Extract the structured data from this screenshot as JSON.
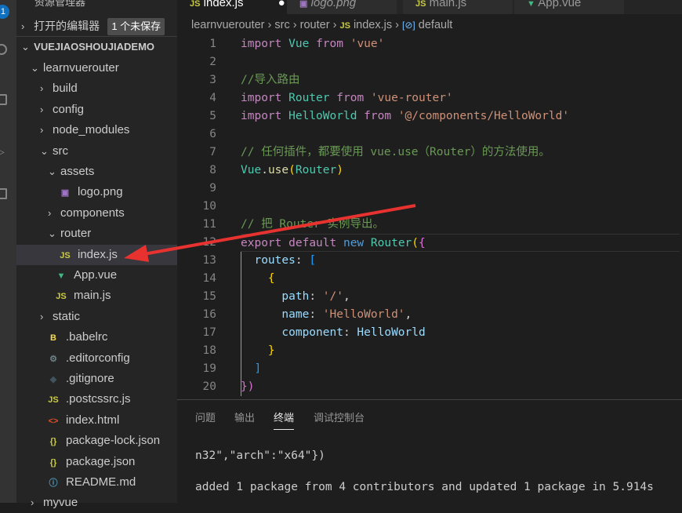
{
  "activity": {
    "badge": "1"
  },
  "sidebar": {
    "title": "资源管理器",
    "more": "···",
    "open_editors": "打开的编辑器",
    "unsaved": "1 个未保存",
    "project": "VUEJIAOSHOUJIADEMO",
    "items": [
      {
        "label": "learnvuerouter",
        "type": "folder-open",
        "indent": 0
      },
      {
        "label": "build",
        "type": "folder",
        "indent": 1
      },
      {
        "label": "config",
        "type": "folder",
        "indent": 1
      },
      {
        "label": "node_modules",
        "type": "folder",
        "indent": 1
      },
      {
        "label": "src",
        "type": "folder-open",
        "indent": 1
      },
      {
        "label": "assets",
        "type": "folder-open",
        "indent": 2
      },
      {
        "label": "logo.png",
        "type": "image",
        "indent": 3
      },
      {
        "label": "components",
        "type": "folder",
        "indent": 2
      },
      {
        "label": "router",
        "type": "folder-open",
        "indent": 2
      },
      {
        "label": "index.js",
        "type": "js",
        "indent": 3,
        "selected": true
      },
      {
        "label": "App.vue",
        "type": "vue",
        "indent": 2
      },
      {
        "label": "main.js",
        "type": "js",
        "indent": 2
      },
      {
        "label": "static",
        "type": "folder",
        "indent": 1
      },
      {
        "label": ".babelrc",
        "type": "babel",
        "indent": 1
      },
      {
        "label": ".editorconfig",
        "type": "gear",
        "indent": 1
      },
      {
        "label": ".gitignore",
        "type": "git",
        "indent": 1
      },
      {
        "label": ".postcssrc.js",
        "type": "js",
        "indent": 1
      },
      {
        "label": "index.html",
        "type": "html",
        "indent": 1
      },
      {
        "label": "package-lock.json",
        "type": "json",
        "indent": 1
      },
      {
        "label": "package.json",
        "type": "json",
        "indent": 1
      },
      {
        "label": "README.md",
        "type": "info",
        "indent": 1
      },
      {
        "label": "myvue",
        "type": "folder",
        "indent": 0
      }
    ]
  },
  "tabs": [
    {
      "label": "index.js",
      "icon": "JS",
      "active": true,
      "dirty": "●"
    },
    {
      "label": "logo.png",
      "icon": "▣"
    },
    {
      "label": "main.js",
      "icon": "JS"
    },
    {
      "label": "App.vue",
      "icon": "▼"
    }
  ],
  "breadcrumb": {
    "parts": [
      "learnvuerouter",
      "src",
      "router",
      "index.js",
      "default"
    ],
    "js": "JS",
    "symbol": "[⊘]"
  },
  "code": [
    [
      [
        "import",
        "kw"
      ],
      [
        " ",
        "pl"
      ],
      [
        "Vue",
        "cls"
      ],
      [
        " ",
        "pl"
      ],
      [
        "from",
        "kw"
      ],
      [
        " ",
        "pl"
      ],
      [
        "'vue'",
        "str"
      ]
    ],
    [],
    [
      [
        "//导入路由",
        "cm"
      ]
    ],
    [
      [
        "import",
        "kw"
      ],
      [
        " ",
        "pl"
      ],
      [
        "Router",
        "cls"
      ],
      [
        " ",
        "pl"
      ],
      [
        "from",
        "kw"
      ],
      [
        " ",
        "pl"
      ],
      [
        "'vue-router'",
        "str"
      ]
    ],
    [
      [
        "import",
        "kw"
      ],
      [
        " ",
        "pl"
      ],
      [
        "HelloWorld",
        "cls"
      ],
      [
        " ",
        "pl"
      ],
      [
        "from",
        "kw"
      ],
      [
        " ",
        "pl"
      ],
      [
        "'@/components/HelloWorld'",
        "str"
      ]
    ],
    [],
    [
      [
        "// 任何插件，都要使用 vue.use（Router）的方法使用。",
        "cm"
      ]
    ],
    [
      [
        "Vue",
        "cls"
      ],
      [
        ".",
        "pl"
      ],
      [
        "use",
        "fn"
      ],
      [
        "(",
        "br1"
      ],
      [
        "Router",
        "cls"
      ],
      [
        ")",
        "br1"
      ]
    ],
    [],
    [],
    [
      [
        "// 把 Router 实例导出。",
        "cm"
      ]
    ],
    [
      [
        "export",
        "kw"
      ],
      [
        " ",
        "pl"
      ],
      [
        "default",
        "kw"
      ],
      [
        " ",
        "pl"
      ],
      [
        "new",
        "blue"
      ],
      [
        " ",
        "pl"
      ],
      [
        "Router",
        "cls"
      ],
      [
        "(",
        "br1"
      ],
      [
        "{",
        "br2"
      ]
    ],
    [
      [
        "  routes",
        "var"
      ],
      [
        ": ",
        "pl"
      ],
      [
        "[",
        "br3"
      ]
    ],
    [
      [
        "    {",
        "br1"
      ]
    ],
    [
      [
        "      path",
        "var"
      ],
      [
        ": ",
        "pl"
      ],
      [
        "'/'",
        "str"
      ],
      [
        ",",
        "pl"
      ]
    ],
    [
      [
        "      name",
        "var"
      ],
      [
        ": ",
        "pl"
      ],
      [
        "'HelloWorld'",
        "str"
      ],
      [
        ",",
        "pl"
      ]
    ],
    [
      [
        "      component",
        "var"
      ],
      [
        ": ",
        "pl"
      ],
      [
        "HelloWorld",
        "var"
      ]
    ],
    [
      [
        "    }",
        "br1"
      ]
    ],
    [
      [
        "  ]",
        "br3"
      ]
    ],
    [
      [
        "})",
        "br2"
      ]
    ]
  ],
  "panel": {
    "tabs": [
      "问题",
      "输出",
      "终端",
      "调试控制台"
    ],
    "active": 2,
    "lines": [
      "n32\",\"arch\":\"x64\"})",
      "added 1 package from 4 contributors and updated 1 package in 5.914s"
    ]
  },
  "annotation": {
    "arrow_color": "#e8322f"
  }
}
